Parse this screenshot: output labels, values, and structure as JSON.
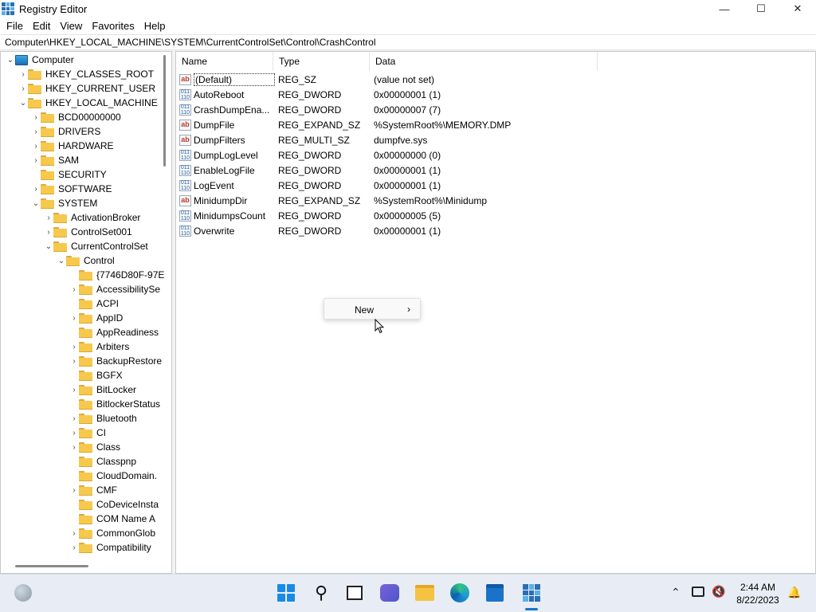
{
  "window": {
    "title": "Registry Editor",
    "controls": {
      "minimize": "—",
      "maximize": "☐",
      "close": "✕"
    }
  },
  "menu": [
    "File",
    "Edit",
    "View",
    "Favorites",
    "Help"
  ],
  "address": "Computer\\HKEY_LOCAL_MACHINE\\SYSTEM\\CurrentControlSet\\Control\\CrashControl",
  "tree": [
    {
      "label": "Computer",
      "chevron": "⌄",
      "kind": "computer"
    },
    {
      "label": "HKEY_CLASSES_ROOT",
      "chevron": "›"
    },
    {
      "label": "HKEY_CURRENT_USER",
      "chevron": "›"
    },
    {
      "label": "HKEY_LOCAL_MACHINE",
      "chevron": "⌄"
    },
    {
      "label": "BCD00000000",
      "chevron": "›"
    },
    {
      "label": "DRIVERS",
      "chevron": "›"
    },
    {
      "label": "HARDWARE",
      "chevron": "›"
    },
    {
      "label": "SAM",
      "chevron": "›"
    },
    {
      "label": "SECURITY",
      "chevron": ""
    },
    {
      "label": "SOFTWARE",
      "chevron": "›"
    },
    {
      "label": "SYSTEM",
      "chevron": "⌄"
    },
    {
      "label": "ActivationBroker",
      "chevron": "›"
    },
    {
      "label": "ControlSet001",
      "chevron": "›"
    },
    {
      "label": "CurrentControlSet",
      "chevron": "⌄"
    },
    {
      "label": "Control",
      "chevron": "⌄"
    },
    {
      "label": "{7746D80F-97E",
      "chevron": ""
    },
    {
      "label": "AccessibilitySe",
      "chevron": "›"
    },
    {
      "label": "ACPI",
      "chevron": ""
    },
    {
      "label": "AppID",
      "chevron": "›"
    },
    {
      "label": "AppReadiness",
      "chevron": ""
    },
    {
      "label": "Arbiters",
      "chevron": "›"
    },
    {
      "label": "BackupRestore",
      "chevron": "›"
    },
    {
      "label": "BGFX",
      "chevron": ""
    },
    {
      "label": "BitLocker",
      "chevron": "›"
    },
    {
      "label": "BitlockerStatus",
      "chevron": ""
    },
    {
      "label": "Bluetooth",
      "chevron": "›"
    },
    {
      "label": "CI",
      "chevron": "›"
    },
    {
      "label": "Class",
      "chevron": "›"
    },
    {
      "label": "Classpnp",
      "chevron": ""
    },
    {
      "label": "CloudDomain.",
      "chevron": ""
    },
    {
      "label": "CMF",
      "chevron": "›"
    },
    {
      "label": "CoDeviceInsta",
      "chevron": ""
    },
    {
      "label": "COM Name A",
      "chevron": ""
    },
    {
      "label": "CommonGlob",
      "chevron": "›"
    },
    {
      "label": "Compatibility",
      "chevron": "›"
    }
  ],
  "values": {
    "headers": {
      "name": "Name",
      "type": "Type",
      "data": "Data"
    },
    "rows": [
      {
        "icon": "ab",
        "name": "(Default)",
        "type": "REG_SZ",
        "data": "(value not set)"
      },
      {
        "icon": "dw",
        "name": "AutoReboot",
        "type": "REG_DWORD",
        "data": "0x00000001 (1)"
      },
      {
        "icon": "dw",
        "name": "CrashDumpEna...",
        "type": "REG_DWORD",
        "data": "0x00000007 (7)"
      },
      {
        "icon": "ab",
        "name": "DumpFile",
        "type": "REG_EXPAND_SZ",
        "data": "%SystemRoot%\\MEMORY.DMP"
      },
      {
        "icon": "ab",
        "name": "DumpFilters",
        "type": "REG_MULTI_SZ",
        "data": "dumpfve.sys"
      },
      {
        "icon": "dw",
        "name": "DumpLogLevel",
        "type": "REG_DWORD",
        "data": "0x00000000 (0)"
      },
      {
        "icon": "dw",
        "name": "EnableLogFile",
        "type": "REG_DWORD",
        "data": "0x00000001 (1)"
      },
      {
        "icon": "dw",
        "name": "LogEvent",
        "type": "REG_DWORD",
        "data": "0x00000001 (1)"
      },
      {
        "icon": "ab",
        "name": "MinidumpDir",
        "type": "REG_EXPAND_SZ",
        "data": "%SystemRoot%\\Minidump"
      },
      {
        "icon": "dw",
        "name": "MinidumpsCount",
        "type": "REG_DWORD",
        "data": "0x00000005 (5)"
      },
      {
        "icon": "dw",
        "name": "Overwrite",
        "type": "REG_DWORD",
        "data": "0x00000001 (1)"
      }
    ]
  },
  "context_menu": {
    "item": "New",
    "arrow": "›"
  },
  "taskbar": {
    "search_glyph": "⚲",
    "tray_chevron": "⌃",
    "volume_glyph": "🔇",
    "notify_glyph": "🔔",
    "time": "2:44 AM",
    "date": "8/22/2023"
  },
  "colors": {
    "accent": "#1a73c9",
    "folder": "#f6c94d",
    "background": "#f3f3f3"
  }
}
